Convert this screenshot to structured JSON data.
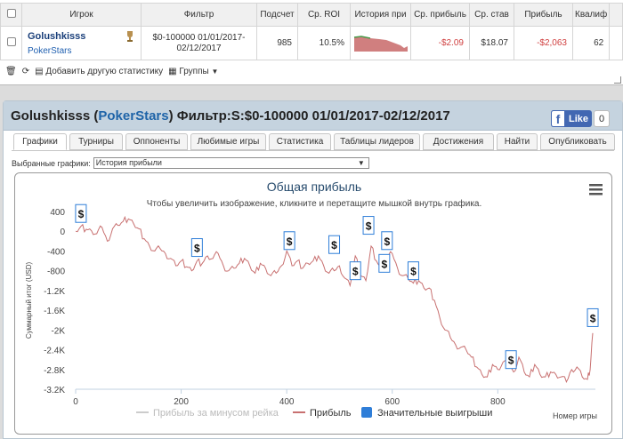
{
  "stats_table": {
    "headers": [
      "Игрок",
      "Фильтр",
      "Подсчет",
      "Ср. ROI",
      "История при",
      "Ср. прибыль",
      "Ср. став",
      "Прибыль",
      "Квалиф"
    ],
    "row": {
      "player": "Golushkisss",
      "site": "PokerStars",
      "filter": "$0-100000 01/01/2017- 02/12/2017",
      "count": "985",
      "roi": "10.5%",
      "avg_profit": "-$2.09",
      "avg_stake": "$18.07",
      "profit": "-$2,063",
      "qualif": "62"
    }
  },
  "toolbar": {
    "add_stats": "Добавить другую статистику",
    "groups": "Группы"
  },
  "header": {
    "player": "Golushkisss",
    "site": "PokerStars",
    "filter_text": "Фильтр:S:$0-100000 01/01/2017-02/12/2017",
    "like_label": "Like",
    "like_count": "0"
  },
  "tabs": [
    "Графики",
    "Турниры",
    "Оппоненты",
    "Любимые игры",
    "Статистика",
    "Таблицы лидеров",
    "Достижения",
    "Найти",
    "Опубликовать"
  ],
  "graph_select": {
    "label": "Выбранные графики:",
    "value": "История прибыли"
  },
  "chart_data": {
    "type": "line",
    "title": "Общая прибыль",
    "subtitle": "Чтобы увеличить изображение, кликните и перетащите мышкой внутрь графика.",
    "xlabel": "Номер игры",
    "ylabel": "Суммарный итог (USD)",
    "xlim": [
      0,
      985
    ],
    "ylim": [
      -3200,
      400
    ],
    "x_ticks": [
      "0",
      "200",
      "400",
      "600",
      "800"
    ],
    "y_ticks": [
      "400",
      "0",
      "-400",
      "-800",
      "-1.2K",
      "-1.6K",
      "-2K",
      "-2.4K",
      "-2.8K",
      "-3.2K"
    ],
    "legend": [
      "Прибыль за минусом рейка",
      "Прибыль",
      "Значительные выигрыши"
    ],
    "series": [
      {
        "name": "Прибыль",
        "color": "#c87070",
        "x": [
          0,
          10,
          20,
          30,
          40,
          50,
          60,
          70,
          80,
          90,
          100,
          110,
          120,
          130,
          140,
          150,
          160,
          170,
          180,
          190,
          200,
          210,
          220,
          230,
          240,
          250,
          260,
          270,
          280,
          290,
          300,
          310,
          320,
          330,
          340,
          350,
          360,
          370,
          380,
          390,
          400,
          410,
          420,
          430,
          440,
          450,
          460,
          470,
          480,
          490,
          500,
          510,
          520,
          530,
          540,
          550,
          560,
          570,
          580,
          590,
          600,
          610,
          620,
          630,
          640,
          650,
          660,
          670,
          680,
          690,
          700,
          710,
          720,
          730,
          740,
          750,
          760,
          770,
          780,
          790,
          800,
          810,
          820,
          830,
          840,
          850,
          860,
          870,
          880,
          890,
          900,
          910,
          920,
          930,
          940,
          950,
          960,
          970,
          975,
          980
        ],
        "values": [
          0,
          100,
          40,
          10,
          -50,
          80,
          -200,
          50,
          120,
          200,
          250,
          150,
          50,
          -150,
          -300,
          -400,
          -350,
          -450,
          -550,
          -700,
          -600,
          -720,
          -800,
          -600,
          -650,
          -500,
          -550,
          -450,
          -700,
          -800,
          -750,
          -650,
          -550,
          -700,
          -850,
          -650,
          -750,
          -900,
          -850,
          -700,
          -400,
          -700,
          -600,
          -750,
          -650,
          -600,
          -500,
          -700,
          -850,
          -800,
          -700,
          -950,
          -1100,
          -500,
          -900,
          -1000,
          -300,
          -600,
          -800,
          -550,
          -450,
          -750,
          -900,
          -950,
          -1050,
          -1000,
          -1150,
          -1150,
          -1400,
          -1750,
          -2000,
          -2150,
          -2300,
          -2350,
          -2400,
          -2550,
          -2750,
          -2900,
          -2950,
          -2700,
          -2800,
          -2650,
          -2700,
          -2850,
          -2550,
          -2850,
          -2950,
          -2700,
          -2900,
          -2950,
          -2850,
          -2900,
          -2950,
          -3050,
          -2800,
          -2750,
          -2950,
          -3000,
          -2800,
          -2063
        ]
      }
    ],
    "big_win_markers": [
      {
        "x": 10,
        "y": 360
      },
      {
        "x": 230,
        "y": -330
      },
      {
        "x": 405,
        "y": -190
      },
      {
        "x": 490,
        "y": -270
      },
      {
        "x": 530,
        "y": -800
      },
      {
        "x": 555,
        "y": 120
      },
      {
        "x": 585,
        "y": -650
      },
      {
        "x": 590,
        "y": -190
      },
      {
        "x": 640,
        "y": -800
      },
      {
        "x": 825,
        "y": -2600
      },
      {
        "x": 980,
        "y": -1750
      }
    ]
  }
}
